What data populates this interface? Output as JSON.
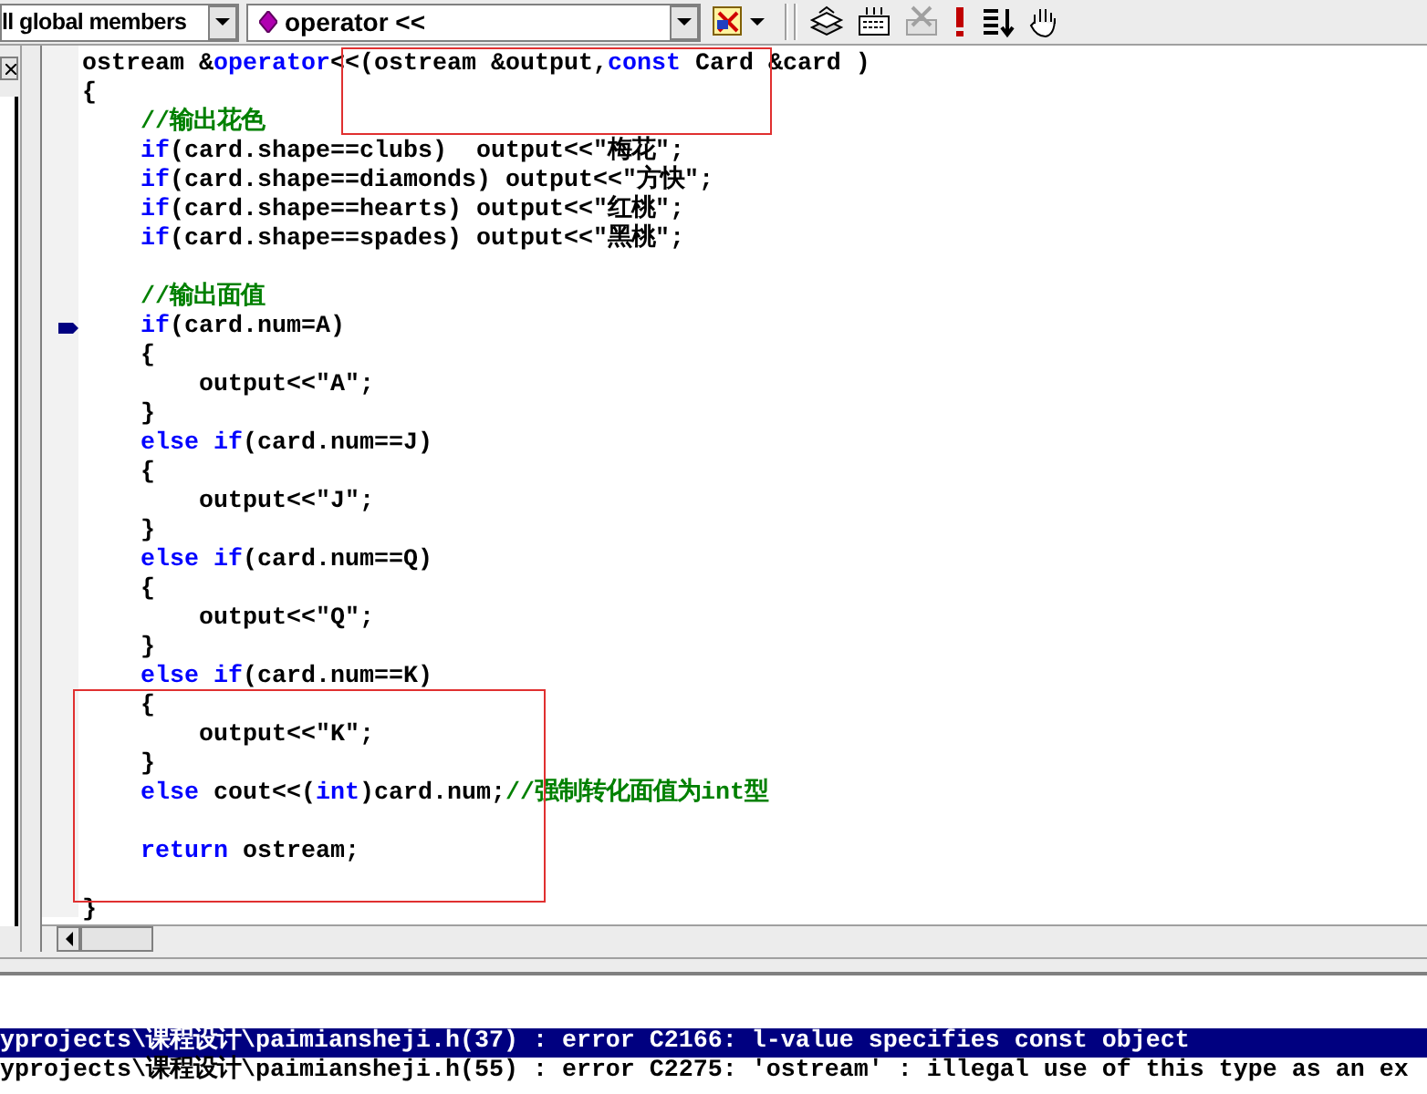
{
  "toolbar": {
    "scope_combo": "ll global members",
    "member_combo": "operator <<"
  },
  "editor": {
    "lines": [
      {
        "current": false,
        "segments": [
          {
            "kind": "plain",
            "text": "ostream &"
          },
          {
            "kind": "keyword",
            "text": "operator"
          },
          {
            "kind": "plain",
            "text": "<<(ostream &output,"
          },
          {
            "kind": "keyword",
            "text": "const"
          },
          {
            "kind": "plain",
            "text": " Card &card )"
          }
        ]
      },
      {
        "current": false,
        "segments": [
          {
            "kind": "plain",
            "text": "{"
          }
        ]
      },
      {
        "current": false,
        "segments": [
          {
            "kind": "comment",
            "text": "    //输出花色"
          }
        ]
      },
      {
        "current": false,
        "segments": [
          {
            "kind": "keyword",
            "text": "    if"
          },
          {
            "kind": "plain",
            "text": "(card.shape==clubs)  output<<\"梅花\";"
          }
        ]
      },
      {
        "current": false,
        "segments": [
          {
            "kind": "keyword",
            "text": "    if"
          },
          {
            "kind": "plain",
            "text": "(card.shape==diamonds) output<<\"方快\";"
          }
        ]
      },
      {
        "current": false,
        "segments": [
          {
            "kind": "keyword",
            "text": "    if"
          },
          {
            "kind": "plain",
            "text": "(card.shape==hearts) output<<\"红桃\";"
          }
        ]
      },
      {
        "current": false,
        "segments": [
          {
            "kind": "keyword",
            "text": "    if"
          },
          {
            "kind": "plain",
            "text": "(card.shape==spades) output<<\"黑桃\";"
          }
        ]
      },
      {
        "current": false
      },
      {
        "current": false,
        "segments": [
          {
            "kind": "comment",
            "text": "    //输出面值"
          }
        ]
      },
      {
        "current": true,
        "segments": [
          {
            "kind": "keyword",
            "text": "    if"
          },
          {
            "kind": "plain",
            "text": "(card.num=A)"
          }
        ]
      },
      {
        "current": false,
        "segments": [
          {
            "kind": "plain",
            "text": "    {"
          }
        ]
      },
      {
        "current": false,
        "segments": [
          {
            "kind": "plain",
            "text": "        output<<\"A\";"
          }
        ]
      },
      {
        "current": false,
        "segments": [
          {
            "kind": "plain",
            "text": "    }"
          }
        ]
      },
      {
        "current": false,
        "segments": [
          {
            "kind": "keyword",
            "text": "    else if"
          },
          {
            "kind": "plain",
            "text": "(card.num==J)"
          }
        ]
      },
      {
        "current": false,
        "segments": [
          {
            "kind": "plain",
            "text": "    {"
          }
        ]
      },
      {
        "current": false,
        "segments": [
          {
            "kind": "plain",
            "text": "        output<<\"J\";"
          }
        ]
      },
      {
        "current": false,
        "segments": [
          {
            "kind": "plain",
            "text": "    }"
          }
        ]
      },
      {
        "current": false,
        "segments": [
          {
            "kind": "keyword",
            "text": "    else if"
          },
          {
            "kind": "plain",
            "text": "(card.num==Q)"
          }
        ]
      },
      {
        "current": false,
        "segments": [
          {
            "kind": "plain",
            "text": "    {"
          }
        ]
      },
      {
        "current": false,
        "segments": [
          {
            "kind": "plain",
            "text": "        output<<\"Q\";"
          }
        ]
      },
      {
        "current": false,
        "segments": [
          {
            "kind": "plain",
            "text": "    }"
          }
        ]
      },
      {
        "current": false,
        "segments": [
          {
            "kind": "keyword",
            "text": "    else if"
          },
          {
            "kind": "plain",
            "text": "(card.num==K)"
          }
        ]
      },
      {
        "current": false,
        "segments": [
          {
            "kind": "plain",
            "text": "    {"
          }
        ]
      },
      {
        "current": false,
        "segments": [
          {
            "kind": "plain",
            "text": "        output<<\"K\";"
          }
        ]
      },
      {
        "current": false,
        "segments": [
          {
            "kind": "plain",
            "text": "    }"
          }
        ]
      },
      {
        "current": false,
        "segments": [
          {
            "kind": "keyword",
            "text": "    else"
          },
          {
            "kind": "plain",
            "text": " cout<<("
          },
          {
            "kind": "keyword",
            "text": "int"
          },
          {
            "kind": "plain",
            "text": ")card.num;"
          },
          {
            "kind": "comment",
            "text": "//强制转化面值为int型"
          }
        ]
      },
      {
        "current": false
      },
      {
        "current": false,
        "segments": [
          {
            "kind": "keyword",
            "text": "    return"
          },
          {
            "kind": "plain",
            "text": " ostream;"
          }
        ]
      },
      {
        "current": false
      },
      {
        "current": false,
        "segments": [
          {
            "kind": "plain",
            "text": "}"
          }
        ]
      }
    ]
  },
  "output": {
    "lines": [
      {
        "selected": true,
        "text": "yprojects\\课程设计\\paimiansheji.h(37) : error C2166: l-value specifies const object"
      },
      {
        "selected": false,
        "text": "yprojects\\课程设计\\paimiansheji.h(55) : error C2275: 'ostream' : illegal use of this type as an ex"
      }
    ]
  }
}
